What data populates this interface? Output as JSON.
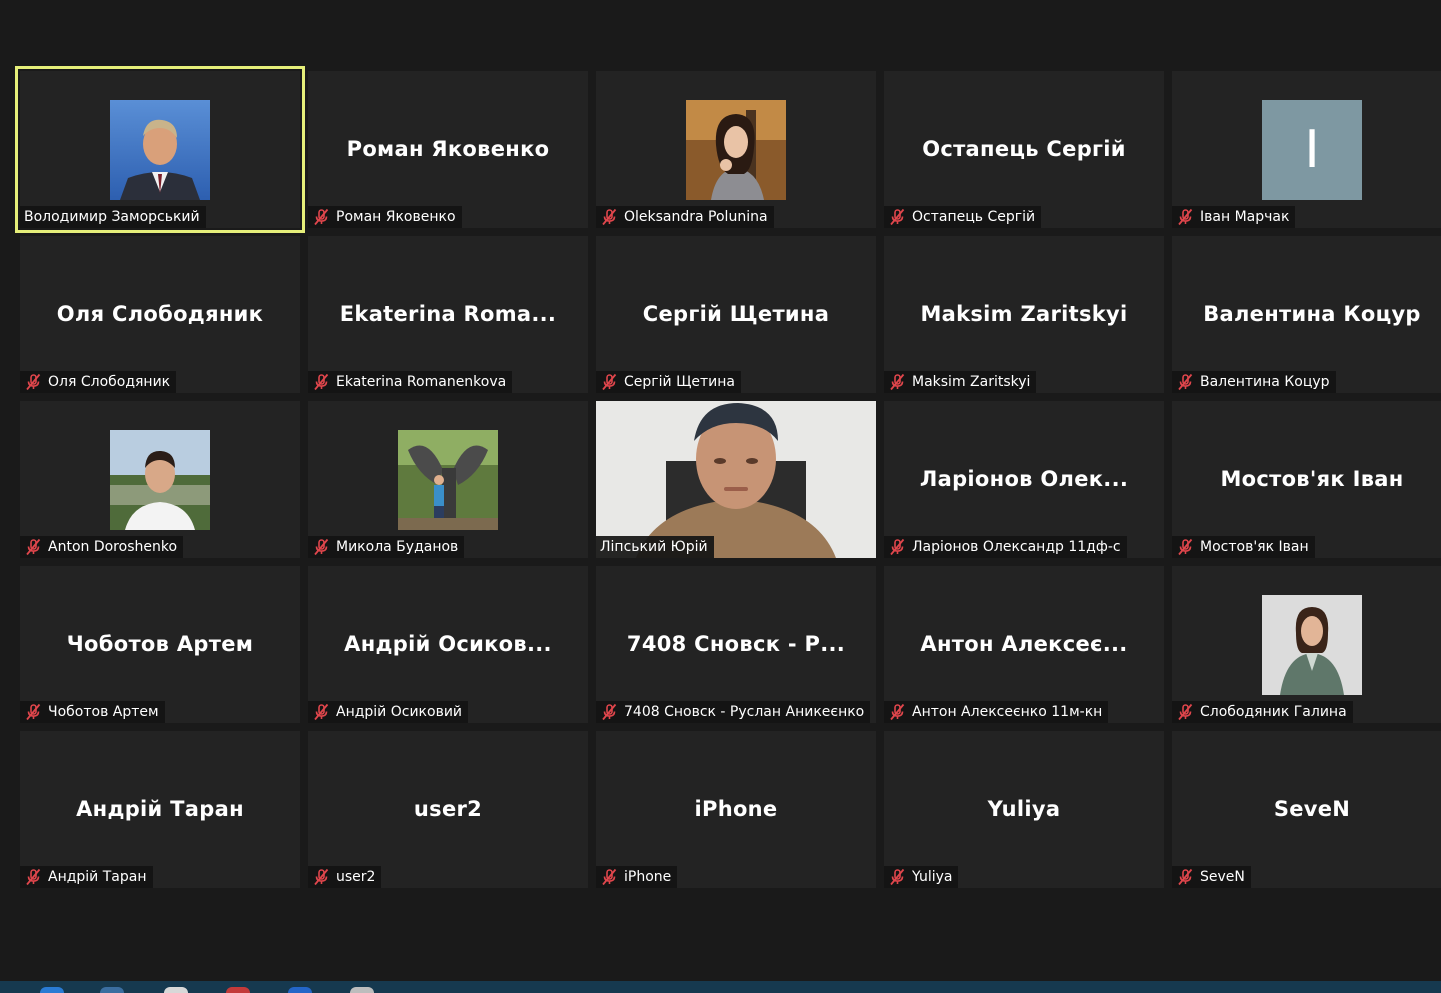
{
  "participants": [
    {
      "display": "Володимир Заморський",
      "label": "Володимир Заморський",
      "muted": false,
      "tile": "avatar",
      "photo": "man-suit",
      "active": true
    },
    {
      "display": "Роман Яковенко",
      "label": "Роман Яковенко",
      "muted": true,
      "tile": "name"
    },
    {
      "display": "Oleksandra Polunina",
      "label": "Oleksandra Polunina",
      "muted": true,
      "tile": "avatar",
      "photo": "woman-autumn"
    },
    {
      "display": "Остапець Сергій",
      "label": "Остапець Сергій",
      "muted": true,
      "tile": "name"
    },
    {
      "display": "I",
      "label": "Іван Марчак",
      "muted": true,
      "tile": "letter"
    },
    {
      "display": "Оля Слободяник",
      "label": "Оля Слободяник",
      "muted": true,
      "tile": "name"
    },
    {
      "display": "Ekaterina  Roma...",
      "label": "Ekaterina Romanenkova",
      "muted": true,
      "tile": "name"
    },
    {
      "display": "Сергій Щетина",
      "label": "Сергій Щетина",
      "muted": true,
      "tile": "name"
    },
    {
      "display": "Maksim Zaritskyi",
      "label": "Maksim Zaritskyi",
      "muted": true,
      "tile": "name"
    },
    {
      "display": "Валентина Коцур",
      "label": "Валентина Коцур",
      "muted": true,
      "tile": "name"
    },
    {
      "display": "Anton Doroshenko",
      "label": "Anton Doroshenko",
      "muted": true,
      "tile": "avatar",
      "photo": "man-white-shirt"
    },
    {
      "display": "Микола Буданов",
      "label": "Микола Буданов",
      "muted": true,
      "tile": "avatar",
      "photo": "statue-park"
    },
    {
      "display": "Ліпський Юрій",
      "label": "Ліпський Юрій",
      "muted": false,
      "tile": "video",
      "photo": "webcam-man"
    },
    {
      "display": "Ларіонов  Олек...",
      "label": "Ларіонов Олександр 11дф-с",
      "muted": true,
      "tile": "name"
    },
    {
      "display": "Мостов'як Іван",
      "label": "Мостов'як Іван",
      "muted": true,
      "tile": "name"
    },
    {
      "display": "Чоботов Артем",
      "label": "Чоботов Артем",
      "muted": true,
      "tile": "name"
    },
    {
      "display": "Андрій  Осиков...",
      "label": "Андрій Осиковий",
      "muted": true,
      "tile": "name"
    },
    {
      "display": "7408  Сновск  -  Р...",
      "label": "7408 Сновск - Руслан Аникеєнко",
      "muted": true,
      "tile": "name"
    },
    {
      "display": "Антон  Алексеє...",
      "label": "Антон Алексеєнко 11м-кн",
      "muted": true,
      "tile": "name"
    },
    {
      "display": "Слободяник Галина",
      "label": "Слободяник Галина",
      "muted": true,
      "tile": "avatar",
      "photo": "woman-green-jacket"
    },
    {
      "display": "Андрій Таран",
      "label": "Андрій Таран",
      "muted": true,
      "tile": "name"
    },
    {
      "display": "user2",
      "label": "user2",
      "muted": true,
      "tile": "name"
    },
    {
      "display": "iPhone",
      "label": "iPhone",
      "muted": true,
      "tile": "name"
    },
    {
      "display": "Yuliya",
      "label": "Yuliya",
      "muted": true,
      "tile": "name"
    },
    {
      "display": "SeveN",
      "label": "SeveN",
      "muted": true,
      "tile": "name"
    }
  ],
  "colors": {
    "background": "#1a1a1a",
    "tile": "#232323",
    "active_speaker_border": "#e6ef7a",
    "muted_icon": "#e0464c",
    "letter_avatar": "#7e98a2",
    "taskbar": "#16394f"
  },
  "icons": {
    "muted": "mic-muted-icon"
  }
}
